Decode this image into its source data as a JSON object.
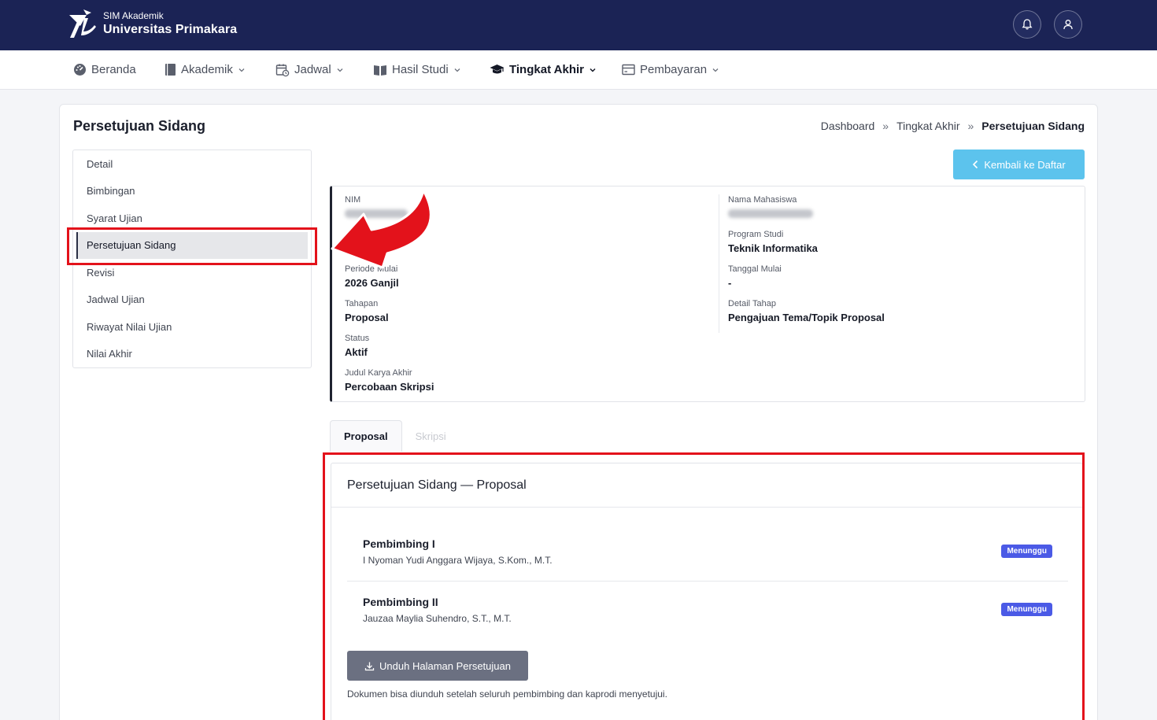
{
  "header": {
    "brand_sub": "SIM Akademik",
    "brand_main": "Universitas Primakara",
    "icons": [
      "bell-icon",
      "user-icon"
    ],
    "color": "#1b2355"
  },
  "nav": {
    "items": [
      {
        "label": "Beranda",
        "icon": "dashboard-icon"
      },
      {
        "label": "Akademik",
        "icon": "book-icon"
      },
      {
        "label": "Jadwal",
        "icon": "calendar-icon"
      },
      {
        "label": "Hasil Studi",
        "icon": "open-book-icon"
      },
      {
        "label": "Tingkat Akhir",
        "icon": "graduation-cap-icon"
      },
      {
        "label": "Pembayaran",
        "icon": "card-icon"
      }
    ]
  },
  "page": {
    "title": "Persetujuan Sidang",
    "breadcrumb": [
      "Dashboard",
      "Tingkat Akhir",
      "Persetujuan Sidang"
    ],
    "back_label": "Kembali ke Daftar"
  },
  "sidemenu": {
    "items": [
      "Detail",
      "Bimbingan",
      "Syarat Ujian",
      "Persetujuan Sidang",
      "Revisi",
      "Jadwal Ujian",
      "Riwayat Nilai Ujian",
      "Nilai Akhir"
    ],
    "active": "Persetujuan Sidang"
  },
  "info": {
    "nim_label": "NIM",
    "nama_label": "Nama Mahasiswa",
    "prodi_label": "Program Studi",
    "prodi_value": "Teknik Informatika",
    "periode_label": "Periode Mulai",
    "periode_value": "2026 Ganjil",
    "tanggal_label": "Tanggal Mulai",
    "tanggal_value": "-",
    "tahapan_label": "Tahapan",
    "tahapan_value": "Proposal",
    "detail_label": "Detail Tahap",
    "detail_value": "Pengajuan Tema/Topik Proposal",
    "status_label": "Status",
    "status_value": "Aktif",
    "judul_label": "Judul Karya Akhir",
    "judul_value": "Percobaan Skripsi"
  },
  "tabs": {
    "proposal": "Proposal",
    "skripsi": "Skripsi"
  },
  "approval": {
    "title": "Persetujuan Sidang — Proposal",
    "advisors": [
      {
        "role": "Pembimbing I",
        "name": "I Nyoman Yudi Anggara Wijaya, S.Kom., M.T.",
        "status": "Menunggu"
      },
      {
        "role": "Pembimbing II",
        "name": "Jauzaa Maylia Suhendro, S.T., M.T.",
        "status": "Menunggu"
      }
    ],
    "download_label": "Unduh Halaman Persetujuan",
    "note": "Dokumen bisa diunduh setelah seluruh pembimbing dan kaprodi menyetujui."
  },
  "colors": {
    "accent": "#5cc3ed",
    "badge": "#4b5ae6",
    "annotation": "#e3121b"
  }
}
